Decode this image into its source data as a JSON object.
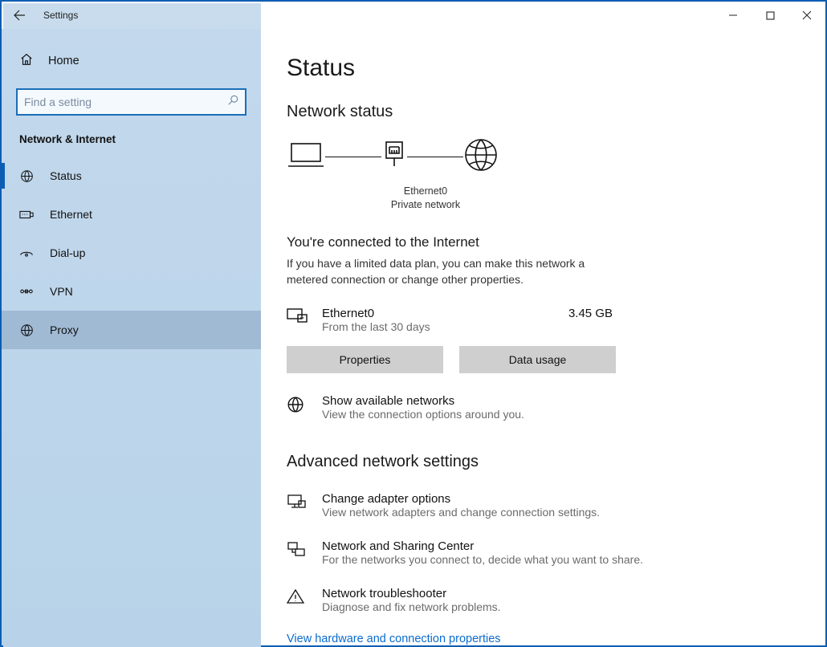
{
  "window": {
    "title": "Settings"
  },
  "sidebar": {
    "home_label": "Home",
    "search_placeholder": "Find a setting",
    "section_label": "Network & Internet",
    "items": [
      {
        "id": "status",
        "label": "Status",
        "active_marker": true
      },
      {
        "id": "ethernet",
        "label": "Ethernet"
      },
      {
        "id": "dialup",
        "label": "Dial-up"
      },
      {
        "id": "vpn",
        "label": "VPN"
      },
      {
        "id": "proxy",
        "label": "Proxy",
        "selected": true
      }
    ]
  },
  "main": {
    "page_title": "Status",
    "section_network_status": "Network status",
    "diagram": {
      "adapter_name": "Ethernet0",
      "network_type": "Private network"
    },
    "connected_heading": "You're connected to the Internet",
    "connected_desc": "If you have a limited data plan, you can make this network a metered connection or change other properties.",
    "connection": {
      "name": "Ethernet0",
      "subtitle": "From the last 30 days",
      "usage": "3.45 GB"
    },
    "buttons": {
      "properties": "Properties",
      "data_usage": "Data usage"
    },
    "available": {
      "title": "Show available networks",
      "sub": "View the connection options around you."
    },
    "section_advanced": "Advanced network settings",
    "adv": [
      {
        "title": "Change adapter options",
        "sub": "View network adapters and change connection settings."
      },
      {
        "title": "Network and Sharing Center",
        "sub": "For the networks you connect to, decide what you want to share."
      },
      {
        "title": "Network troubleshooter",
        "sub": "Diagnose and fix network problems."
      }
    ],
    "link": "View hardware and connection properties"
  }
}
